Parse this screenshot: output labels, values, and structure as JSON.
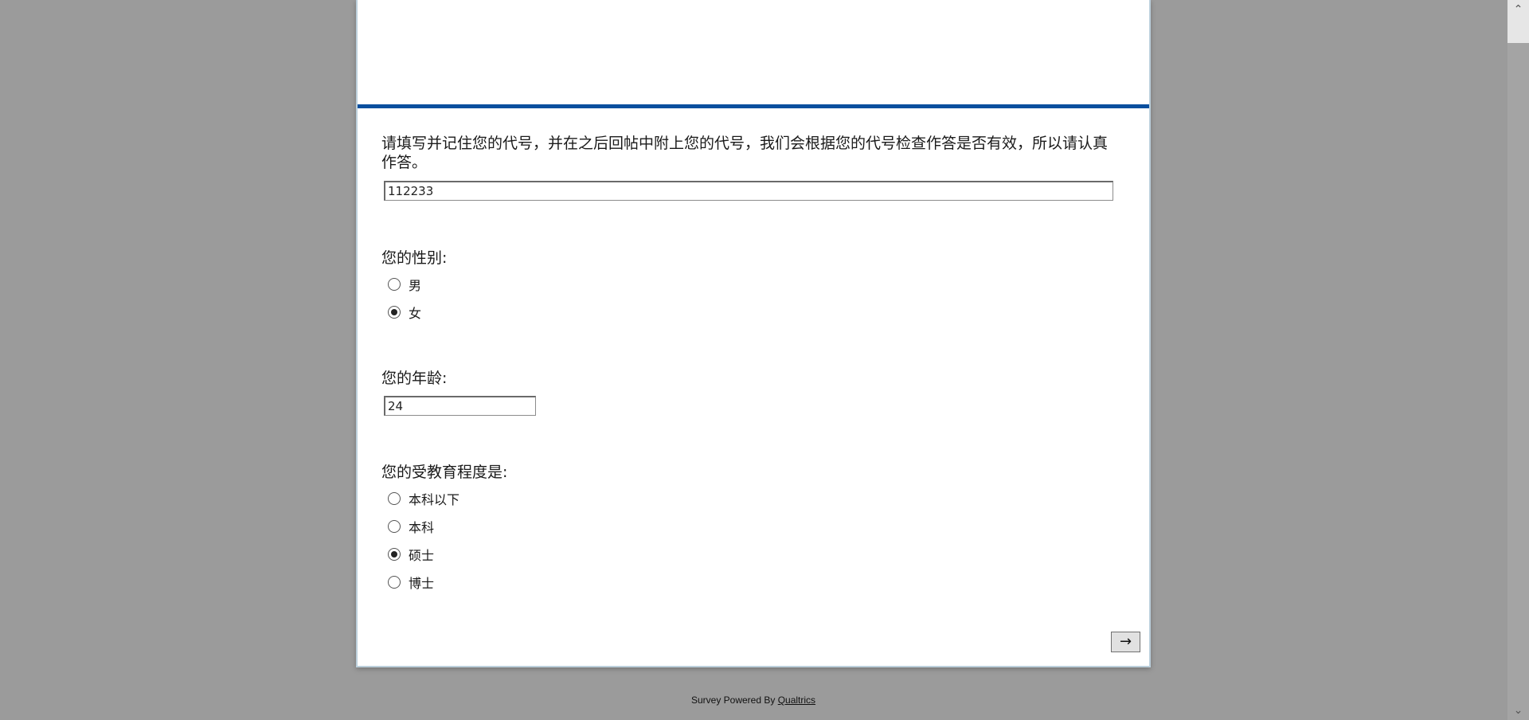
{
  "survey": {
    "q1": {
      "text": "请填写并记住您的代号，并在之后回帖中附上您的代号，我们会根据您的代号检查作答是否有效，所以请认真作答。",
      "value": "112233"
    },
    "q2": {
      "text": "您的性别:",
      "choices": [
        {
          "label": "男",
          "checked": false
        },
        {
          "label": "女",
          "checked": true
        }
      ]
    },
    "q3": {
      "text": "您的年龄:",
      "value": "24"
    },
    "q4": {
      "text": "您的受教育程度是:",
      "choices": [
        {
          "label": "本科以下",
          "checked": false
        },
        {
          "label": "本科",
          "checked": false
        },
        {
          "label": "硕士",
          "checked": true
        },
        {
          "label": "博士",
          "checked": false
        }
      ]
    },
    "next_label": "→"
  },
  "footer": {
    "prefix": "Survey Powered By ",
    "link": "Qualtrics"
  },
  "scrollbar": {
    "up_icon": "chevron-up-icon",
    "down_icon": "chevron-down-icon"
  }
}
